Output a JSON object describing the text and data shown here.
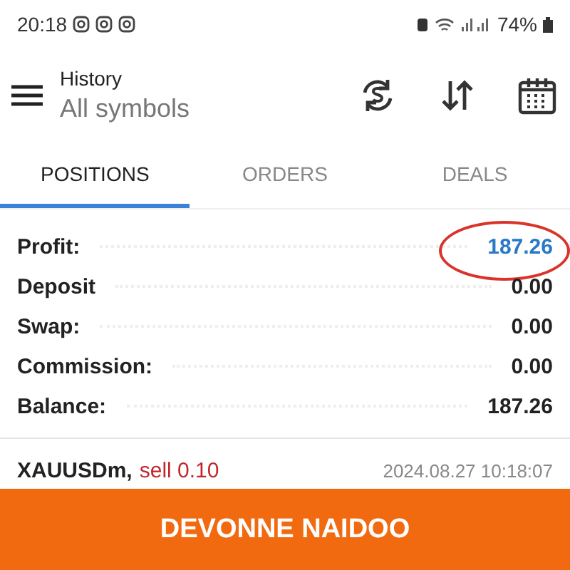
{
  "status_bar": {
    "time": "20:18",
    "battery": "74%"
  },
  "header": {
    "title": "History",
    "subtitle": "All symbols"
  },
  "tabs": [
    {
      "label": "POSITIONS",
      "selected": true
    },
    {
      "label": "ORDERS",
      "selected": false
    },
    {
      "label": "DEALS",
      "selected": false
    }
  ],
  "summary": [
    {
      "label": "Profit:",
      "value": "187.26",
      "kind": "highlight"
    },
    {
      "label": "Deposit",
      "value": "0.00",
      "kind": "plain"
    },
    {
      "label": "Swap:",
      "value": "0.00",
      "kind": "plain"
    },
    {
      "label": "Commission:",
      "value": "0.00",
      "kind": "plain"
    },
    {
      "label": "Balance:",
      "value": "187.26",
      "kind": "plain"
    }
  ],
  "positions": [
    {
      "symbol": "XAUUSDm,",
      "side": "sell 0.10",
      "time": "2024.08.27 10:18:07"
    }
  ],
  "banner": {
    "text": "DEVONNE NAIDOO"
  }
}
